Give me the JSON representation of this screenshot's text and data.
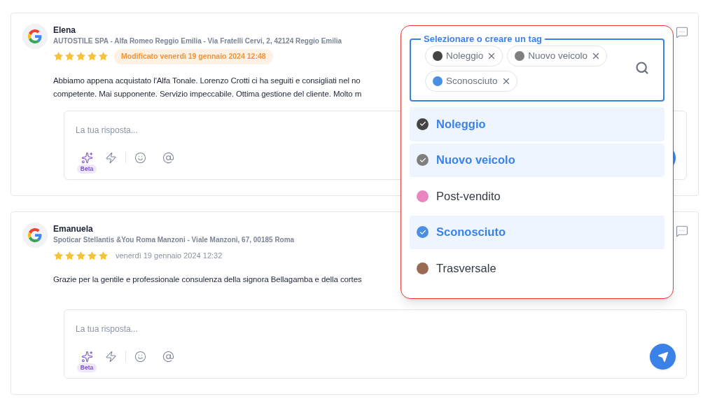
{
  "reviews": [
    {
      "name": "Elena",
      "location": "AUTOSTILE SPA - Alfa Romeo Reggio Emilia - Via Fratelli Cervi, 2, 42124 Reggio Emilia",
      "stars": 5,
      "date": "Modificato venerdì 19 gennaio 2024 12:48",
      "edited": true,
      "text_lines": [
        "Abbiamo appena acquistato l'Alfa Tonale. Lorenzo Crotti ci ha seguiti e consigliati nel no",
        "competente. Mai supponente. Servizio impeccabile. Ottima gestione del cliente. Molto m"
      ],
      "reply": {
        "placeholder": "La tua risposta...",
        "beta": "Beta"
      }
    },
    {
      "name": "Emanuela",
      "location": "Spoticar Stellantis &You Roma Manzoni - Viale Manzoni, 67, 00185 Roma",
      "stars": 5,
      "date": "venerdì 19 gennaio 2024 12:32",
      "edited": false,
      "text_lines": [
        "Grazie per la gentile e professionale consulenza della signora Bellagamba e della cortes"
      ],
      "reply": {
        "placeholder": "La tua risposta...",
        "beta": "Beta"
      }
    }
  ],
  "tag_picker": {
    "legend": "Selezionare o creare un tag",
    "chips": [
      {
        "label": "Noleggio",
        "color": "#444444"
      },
      {
        "label": "Nuovo veicolo",
        "color": "#7f7f7f"
      },
      {
        "label": "Sconosciuto",
        "color": "#4a90e2"
      }
    ],
    "options": [
      {
        "label": "Noleggio",
        "color": "#444444",
        "selected": true
      },
      {
        "label": "Nuovo veicolo",
        "color": "#7f7f7f",
        "selected": true
      },
      {
        "label": "Post-vendito",
        "color": "#e985c1",
        "selected": false
      },
      {
        "label": "Sconosciuto",
        "color": "#4a90e2",
        "selected": true
      },
      {
        "label": "Trasversale",
        "color": "#9a6a55",
        "selected": false
      }
    ]
  }
}
